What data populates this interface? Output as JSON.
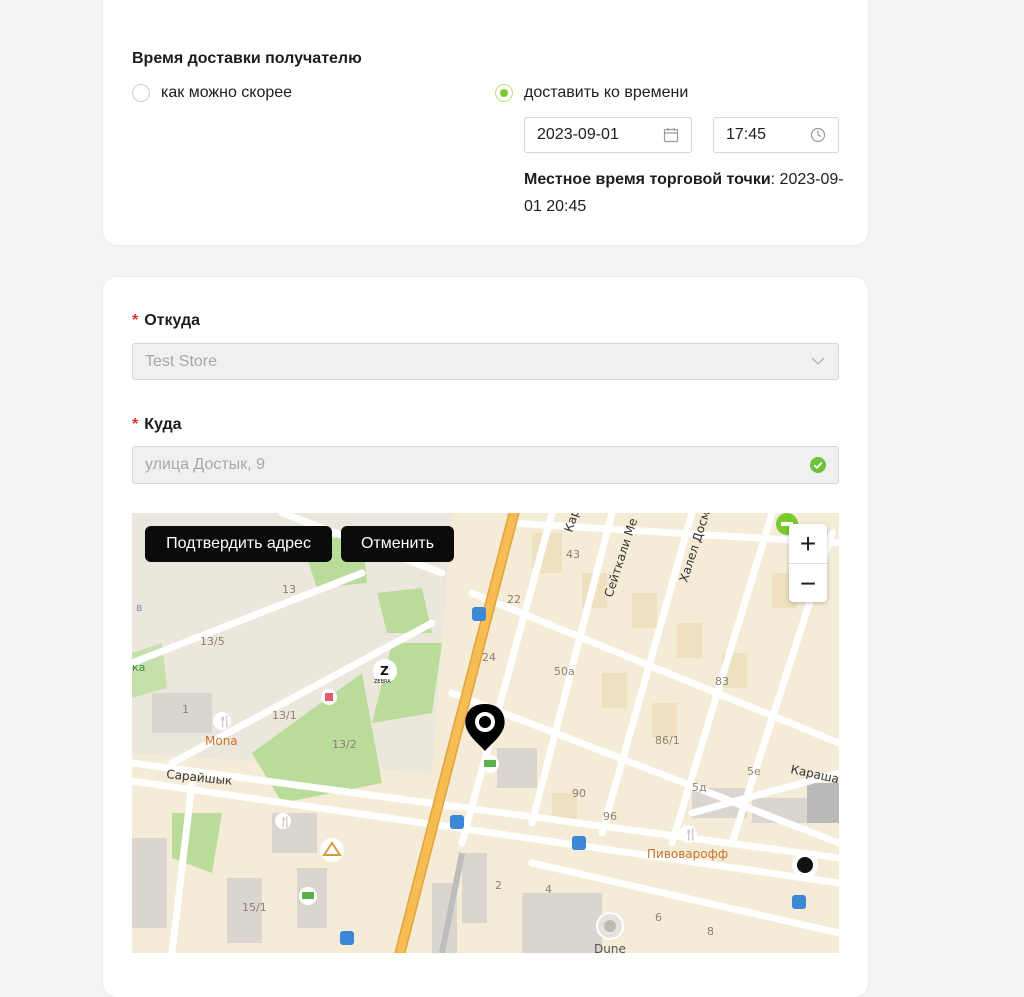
{
  "delivery_time": {
    "title": "Время доставки получателю",
    "option_asap": "как можно скорее",
    "option_scheduled": "доставить ко времени",
    "selected": "option_scheduled",
    "date": "2023-09-01",
    "time": "17:45",
    "local_time_label": "Местное время торговой точки",
    "local_time_value": ": 2023-09-01 20:45"
  },
  "address": {
    "from_label": "Откуда",
    "from_value": "Test Store",
    "to_label": "Куда",
    "to_value": "улица Достык, 9",
    "required_mark": "*"
  },
  "map": {
    "confirm_button": "Подтвердить адрес",
    "cancel_button": "Отменить",
    "zoom_in": "+",
    "zoom_out": "−",
    "street_labels": [
      "Сарайшык",
      "Карашаш",
      "Сейткали Ме",
      "Халел Досм",
      "Кар"
    ],
    "poi_labels": [
      "Mona",
      "Пивоварофф",
      "Dune",
      "ZEBRA"
    ],
    "building_numbers": [
      "13",
      "13/5",
      "1",
      "13/1",
      "13/2",
      "22",
      "24",
      "43",
      "50а",
      "83",
      "86/1",
      "90",
      "96",
      "5д",
      "5е",
      "15/1",
      "2",
      "4",
      "6",
      "8",
      "ка",
      "в"
    ]
  },
  "colors": {
    "accent": "#7cc92f",
    "required": "#e4322b",
    "button_dark": "#0b0b0b",
    "main_road": "#f2b44b",
    "green_area": "#b9dc9a",
    "map_bg": "#f4ecd6"
  }
}
